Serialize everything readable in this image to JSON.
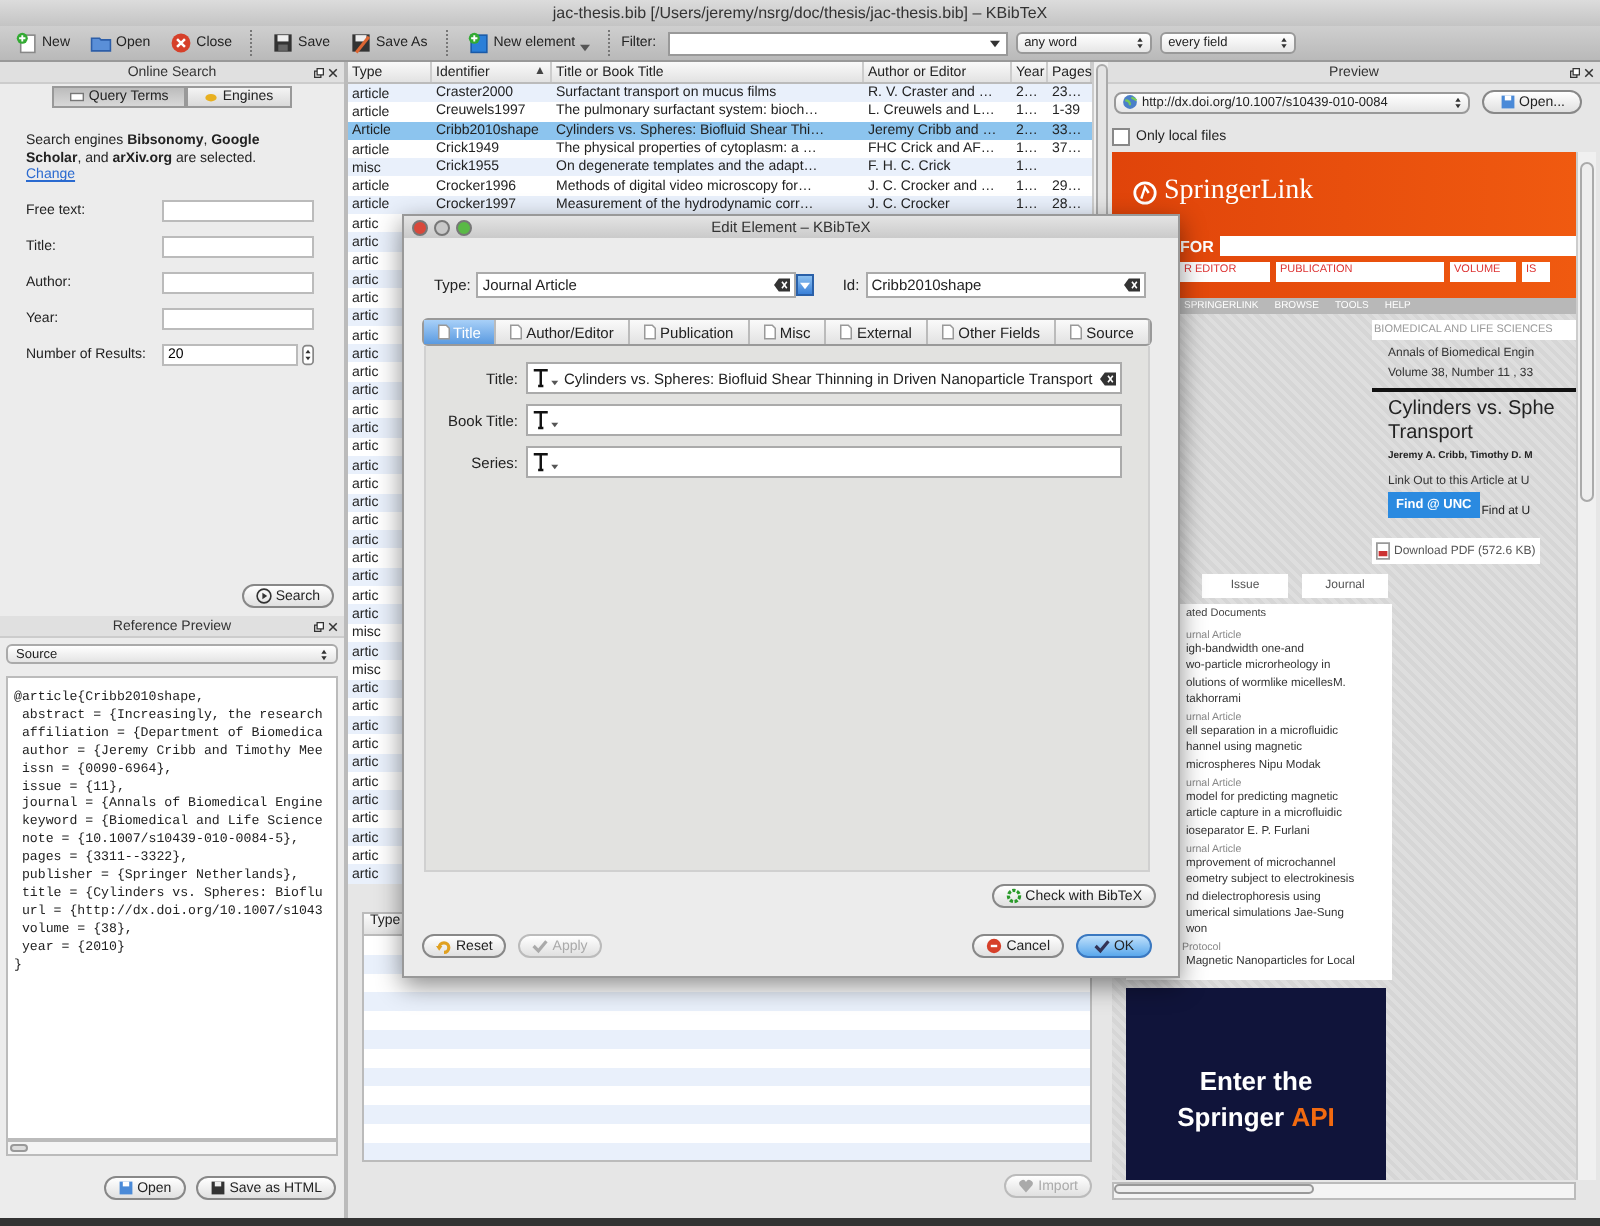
{
  "window": {
    "title": "jac-thesis.bib [/Users/jeremy/nsrg/doc/thesis/jac-thesis.bib] – KBibTeX"
  },
  "toolbar": {
    "groups": [
      [
        {
          "label": "New",
          "kind": "new"
        },
        {
          "label": "Open",
          "kind": "open"
        },
        {
          "label": "Close",
          "kind": "close"
        }
      ],
      [
        {
          "label": "Save",
          "kind": "save"
        },
        {
          "label": "Save As",
          "kind": "save-as"
        }
      ],
      [
        {
          "label": "New element",
          "kind": "new-element"
        }
      ]
    ],
    "filter_label": "Filter:",
    "match_select": "any word",
    "field_select": "every field"
  },
  "online_search": {
    "title": "Online Search",
    "tabs": [
      {
        "label": "Query Terms",
        "kind": "query",
        "selected": true
      },
      {
        "label": "Engines",
        "kind": "engines",
        "selected": false
      }
    ],
    "description": "Search engines **Bibsonomy**, **Google Scholar**, and **arXiv.org** are selected.",
    "link": "Change",
    "fields": [
      {
        "label": "Free text:",
        "kind": "text"
      },
      {
        "label": "Title:",
        "kind": "text"
      },
      {
        "label": "Author:",
        "kind": "text"
      },
      {
        "label": "Year:",
        "kind": "text"
      },
      {
        "label": "Number of Results:",
        "kind": "spin",
        "value": "20"
      }
    ],
    "search_button": "Search"
  },
  "reference_preview": {
    "title": "Reference Preview",
    "view_select": "Source",
    "source": [
      "@article{Cribb2010shape,",
      " abstract = {Increasingly, the research",
      " affiliation = {Department of Biomedica",
      " author = {Jeremy Cribb and Timothy Mee",
      " issn = {0090-6964},",
      " issue = {11},",
      " journal = {Annals of Biomedical Engine",
      " keyword = {Biomedical and Life Science",
      " note = {10.1007/s10439-010-0084-5},",
      " pages = {3311--3322},",
      " publisher = {Springer Netherlands},",
      " title = {Cylinders vs. Spheres: Bioflu",
      " url = {http://dx.doi.org/10.1007/s1043",
      " volume = {38},",
      " year = {2010}",
      "}"
    ],
    "buttons": [
      {
        "label": "Open",
        "kind": "open"
      },
      {
        "label": "Save as HTML",
        "kind": "save"
      }
    ]
  },
  "table": {
    "columns": [
      {
        "label": "Type"
      },
      {
        "label": "Identifier",
        "sort_mark": "▲"
      },
      {
        "label": "Title or Book Title"
      },
      {
        "label": "Author or Editor"
      },
      {
        "label": "Year"
      },
      {
        "label": "Pages"
      }
    ],
    "rows": [
      {
        "type": "article",
        "identifier": "Craster2000",
        "title": "Surfactant transport on mucus films",
        "author": "R. V. Craster and …",
        "year": "2…",
        "pages": "23…",
        "selected": false
      },
      {
        "type": "article",
        "identifier": "Creuwels1997",
        "title": "The pulmonary surfactant system: bioch…",
        "author": "L. Creuwels and L…",
        "year": "1…",
        "pages": "1-39",
        "selected": false
      },
      {
        "type": "Article",
        "identifier": "Cribb2010shape",
        "title": "Cylinders vs. Spheres: Biofluid Shear Thi…",
        "author": "Jeremy Cribb and …",
        "year": "2…",
        "pages": "33…",
        "selected": true
      },
      {
        "type": "article",
        "identifier": "Crick1949",
        "title": "The physical properties of cytoplasm: a …",
        "author": "FHC Crick and AF…",
        "year": "1…",
        "pages": "37…",
        "selected": false
      },
      {
        "type": "misc",
        "identifier": "Crick1955",
        "title": "On degenerate templates and the adapt…",
        "author": "F. H. C. Crick",
        "year": "1…",
        "selected": false
      },
      {
        "type": "article",
        "identifier": "Crocker1996",
        "title": "Methods of digital video microscopy for…",
        "author": "J. C. Crocker and …",
        "year": "1…",
        "pages": "29…",
        "selected": false
      },
      {
        "type": "article",
        "identifier": "Crocker1997",
        "title": "Measurement of the hydrodynamic corr…",
        "author": "J. C. Crocker",
        "year": "1…",
        "pages": "28…",
        "selected": false
      },
      {
        "type": "artic",
        "selected": false
      },
      {
        "type": "artic",
        "selected": false
      },
      {
        "type": "artic",
        "selected": false
      },
      {
        "type": "artic",
        "selected": false
      },
      {
        "type": "artic",
        "selected": false
      },
      {
        "type": "artic",
        "selected": false
      },
      {
        "type": "artic",
        "selected": false
      },
      {
        "type": "artic",
        "selected": false
      },
      {
        "type": "artic",
        "selected": false
      },
      {
        "type": "artic",
        "selected": false
      },
      {
        "type": "artic",
        "selected": false
      },
      {
        "type": "artic",
        "selected": false
      },
      {
        "type": "artic",
        "selected": false
      },
      {
        "type": "artic",
        "selected": false
      },
      {
        "type": "artic",
        "selected": false
      },
      {
        "type": "artic",
        "selected": false
      },
      {
        "type": "artic",
        "selected": false
      },
      {
        "type": "artic",
        "selected": false
      },
      {
        "type": "artic",
        "selected": false
      },
      {
        "type": "artic",
        "selected": false
      },
      {
        "type": "artic",
        "selected": false
      },
      {
        "type": "artic",
        "selected": false
      },
      {
        "type": "misc",
        "selected": false
      },
      {
        "type": "artic",
        "selected": false
      },
      {
        "type": "misc",
        "selected": false
      },
      {
        "type": "artic",
        "selected": false
      },
      {
        "type": "artic",
        "selected": false
      },
      {
        "type": "artic",
        "selected": false
      },
      {
        "type": "artic",
        "selected": false
      },
      {
        "type": "artic",
        "selected": false
      },
      {
        "type": "artic",
        "selected": false
      },
      {
        "type": "artic",
        "selected": false
      },
      {
        "type": "artic",
        "selected": false
      },
      {
        "type": "artic",
        "selected": false
      },
      {
        "type": "artic",
        "selected": false
      },
      {
        "type": "artic",
        "selected": false
      }
    ]
  },
  "lower_table": {
    "columns": [
      "Type"
    ]
  },
  "import_button": {
    "label": "Import",
    "disabled": true
  },
  "preview": {
    "title": "Preview",
    "url": "http://dx.doi.org/10.1007/s10439-010-0084",
    "open_button": "Open...",
    "only_local_files": {
      "label": "Only local files",
      "checked": false
    },
    "web_page": {
      "logo": "SpringerLink",
      "search_label": "FOR",
      "search_fields": [
        "R EDITOR",
        "PUBLICATION",
        "VOLUME",
        "IS"
      ],
      "nav": [
        "SPRINGERLINK",
        "BROWSE",
        "TOOLS",
        "HELP"
      ],
      "category": "BIOMEDICAL AND LIFE SCIENCES",
      "journal": "Annals of Biomedical Engin",
      "volume": "Volume 38, Number 11 , 33",
      "article_title": [
        "Cylinders vs. Sphe",
        "Transport"
      ],
      "authors": "Jeremy A. Cribb, Timothy D. M",
      "link_out": "Link Out to this Article at U",
      "find_button": "Find @ UNC",
      "find_text": "Find at U",
      "pdf_link": "Download PDF (572.6 KB)",
      "tabs": [
        "Issue",
        "Journal"
      ],
      "related_title": "ated Documents",
      "related": [
        {
          "kind": "journal-article",
          "label": "urnal Article",
          "lines": [
            "igh-bandwidth one-and",
            "wo-particle microrheology in",
            "olutions of wormlike micellesM.",
            "takhorrami"
          ]
        },
        {
          "kind": "journal-article",
          "label": "urnal Article",
          "lines": [
            "ell separation in a microfluidic",
            "hannel using magnetic",
            "microspheres  Nipu Modak"
          ]
        },
        {
          "kind": "journal-article",
          "label": "urnal Article",
          "lines": [
            " model for predicting magnetic",
            "article capture in a microfluidic",
            "ioseparator  E. P. Furlani"
          ]
        },
        {
          "kind": "journal-article",
          "label": "urnal Article",
          "lines": [
            "mprovement of microchannel",
            "eometry subject to electrokinesis",
            "nd dielectrophoresis using",
            "umerical simulations Jae-Sung",
            "won"
          ]
        },
        {
          "kind": "protocol",
          "label": "Protocol",
          "lines": [
            "Magnetic Nanoparticles for Local"
          ]
        }
      ],
      "ad": {
        "line1": "Enter the",
        "brand": "Springer",
        "accent": "API"
      }
    }
  },
  "dialog": {
    "title": "Edit Element – KBibTeX",
    "type_label": "Type:",
    "type_value": "Journal Article",
    "id_label": "Id:",
    "id_value": "Cribb2010shape",
    "tabs": [
      {
        "label": "Title",
        "selected": true
      },
      {
        "label": "Author/Editor",
        "selected": false
      },
      {
        "label": "Publication",
        "selected": false
      },
      {
        "label": "Misc",
        "selected": false
      },
      {
        "label": "External",
        "selected": false
      },
      {
        "label": "Other Fields",
        "selected": false
      },
      {
        "label": "Source",
        "selected": false
      }
    ],
    "fields": [
      {
        "label": "Title:",
        "value": "Cylinders vs. Spheres: Biofluid Shear Thinning in Driven Nanoparticle Transport"
      },
      {
        "label": "Book Title:"
      },
      {
        "label": "Series:"
      }
    ],
    "check_button": "Check with BibTeX",
    "left_buttons": [
      {
        "label": "Reset",
        "kind": "reset",
        "disabled": false
      },
      {
        "label": "Apply",
        "kind": "apply",
        "disabled": true
      }
    ],
    "right_buttons": [
      {
        "label": "Cancel",
        "kind": "cancel",
        "default": false
      },
      {
        "label": "OK",
        "kind": "ok",
        "default": true
      }
    ]
  }
}
